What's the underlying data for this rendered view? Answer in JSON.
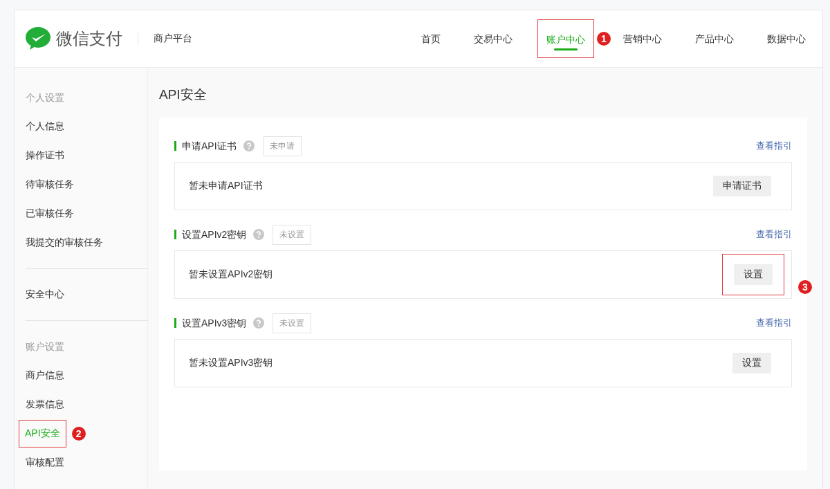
{
  "header": {
    "logo_text": "微信支付",
    "platform": "商户平台"
  },
  "nav": [
    {
      "label": "首页",
      "selected": false
    },
    {
      "label": "交易中心",
      "selected": false
    },
    {
      "label": "账户中心",
      "selected": true,
      "callout": "1"
    },
    {
      "label": "营销中心",
      "selected": false
    },
    {
      "label": "产品中心",
      "selected": false
    },
    {
      "label": "数据中心",
      "selected": false
    }
  ],
  "sidebar": [
    {
      "kind": "heading",
      "label": "个人设置"
    },
    {
      "kind": "item",
      "label": "个人信息",
      "selected": false
    },
    {
      "kind": "item",
      "label": "操作证书",
      "selected": false
    },
    {
      "kind": "item",
      "label": "待审核任务",
      "selected": false
    },
    {
      "kind": "item",
      "label": "已审核任务",
      "selected": false
    },
    {
      "kind": "item",
      "label": "我提交的审核任务",
      "selected": false
    },
    {
      "kind": "divider"
    },
    {
      "kind": "item",
      "label": "安全中心",
      "selected": false
    },
    {
      "kind": "divider"
    },
    {
      "kind": "heading",
      "label": "账户设置"
    },
    {
      "kind": "item",
      "label": "商户信息",
      "selected": false
    },
    {
      "kind": "item",
      "label": "发票信息",
      "selected": false
    },
    {
      "kind": "item",
      "label": "API安全",
      "selected": true,
      "callout": "2"
    },
    {
      "kind": "item",
      "label": "审核配置",
      "selected": false
    }
  ],
  "page_title": "API安全",
  "sections": [
    {
      "title": "申请API证书",
      "status": "未申请",
      "link": "查看指引",
      "message": "暂未申请API证书",
      "button": "申请证书"
    },
    {
      "title": "设置APIv2密钥",
      "status": "未设置",
      "link": "查看指引",
      "message": "暂未设置APIv2密钥",
      "button": "设置",
      "callout": "3"
    },
    {
      "title": "设置APIv3密钥",
      "status": "未设置",
      "link": "查看指引",
      "message": "暂未设置APIv3密钥",
      "button": "设置"
    }
  ]
}
